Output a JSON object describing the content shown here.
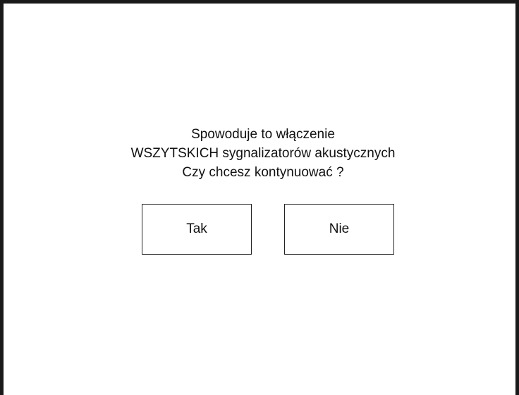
{
  "dialog": {
    "message_lines": [
      "Spowoduje to włączenie",
      "WSZYTSKICH sygnalizatorów akustycznych",
      "Czy chcesz kontynuować ?"
    ],
    "yes_label": "Tak",
    "no_label": "Nie"
  },
  "colors": {
    "frame": "#1a1a1a",
    "background": "#ffffff",
    "text": "#111111"
  }
}
